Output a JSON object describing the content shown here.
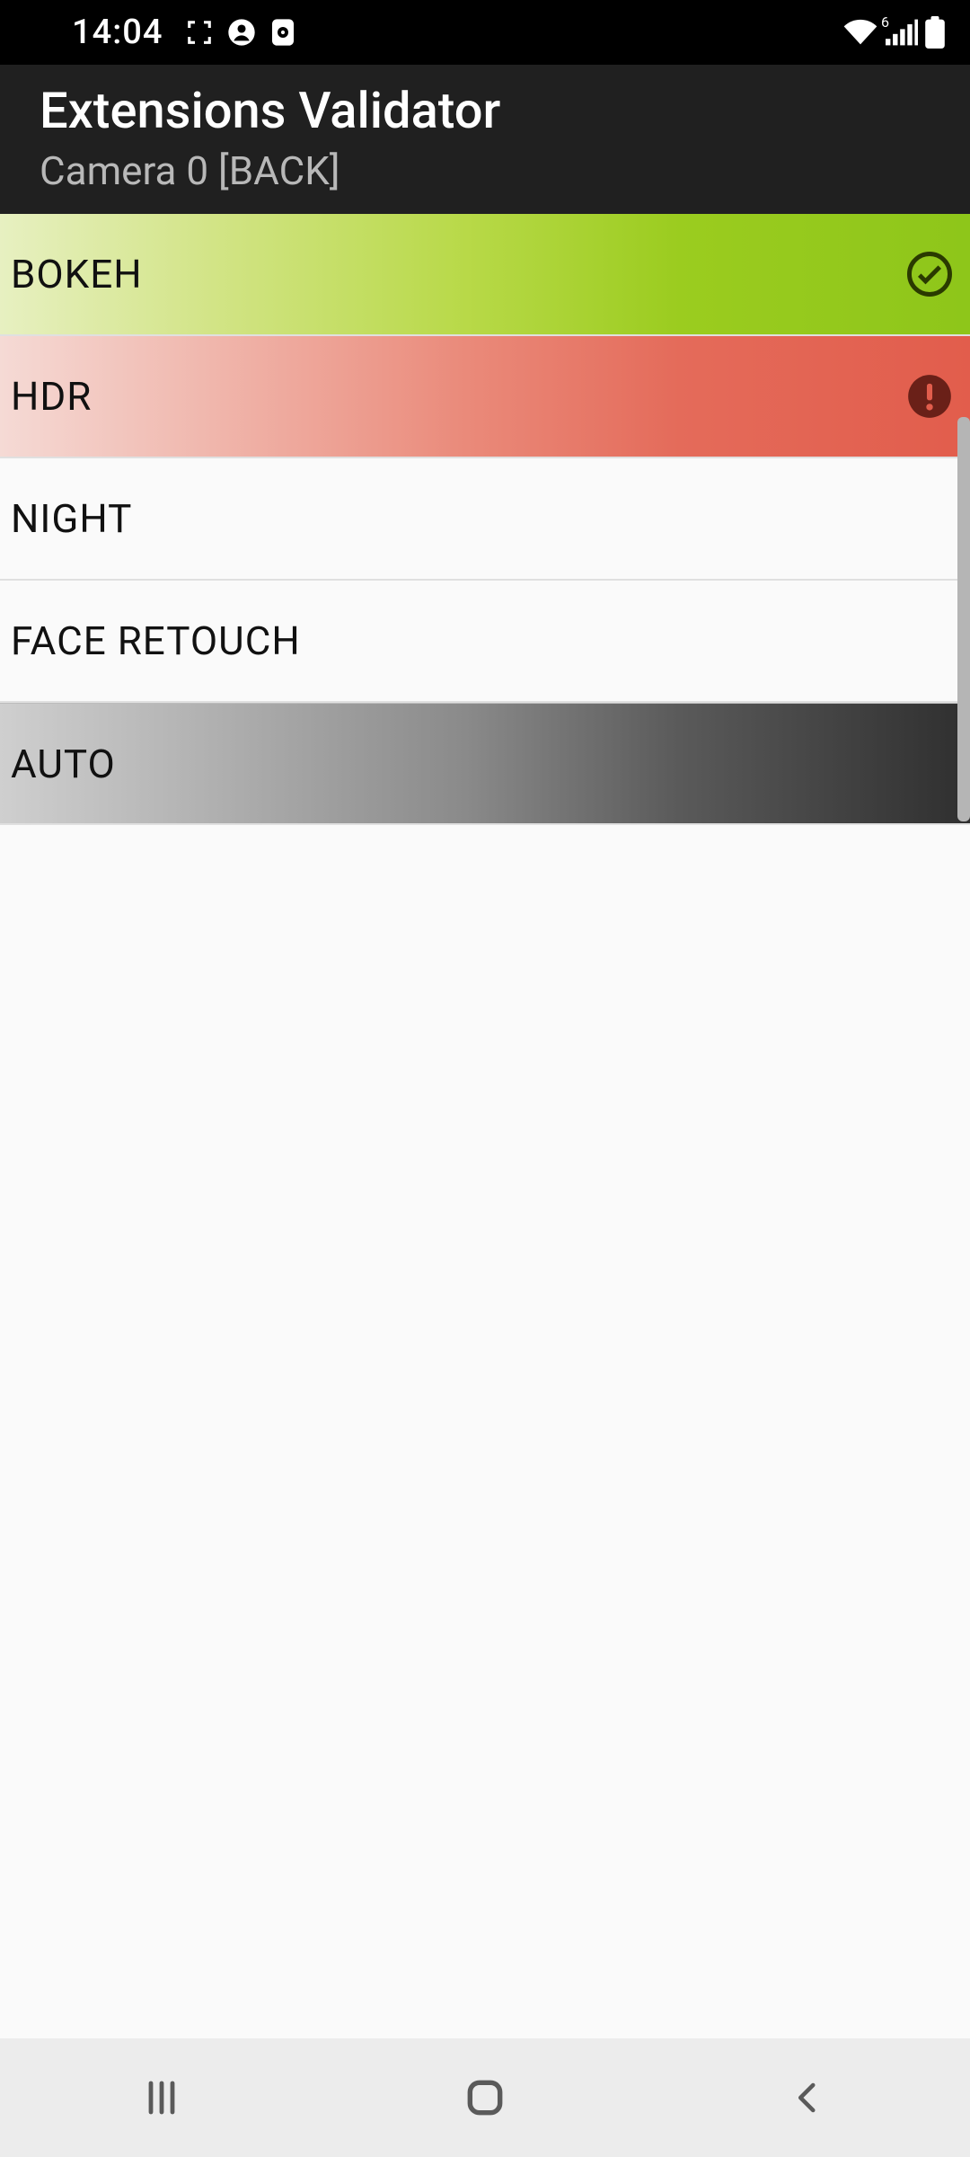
{
  "status": {
    "time": "14:04",
    "wifi_badge": "6"
  },
  "app": {
    "title": "Extensions Validator",
    "subtitle": "Camera 0 [BACK]"
  },
  "rows": [
    {
      "label": "BOKEH",
      "state": "pass",
      "indicator": "check"
    },
    {
      "label": "HDR",
      "state": "fail",
      "indicator": "alert"
    },
    {
      "label": "NIGHT",
      "state": "neutral",
      "indicator": "none"
    },
    {
      "label": "FACE RETOUCH",
      "state": "neutral",
      "indicator": "none"
    },
    {
      "label": "AUTO",
      "state": "running",
      "indicator": "none"
    }
  ]
}
